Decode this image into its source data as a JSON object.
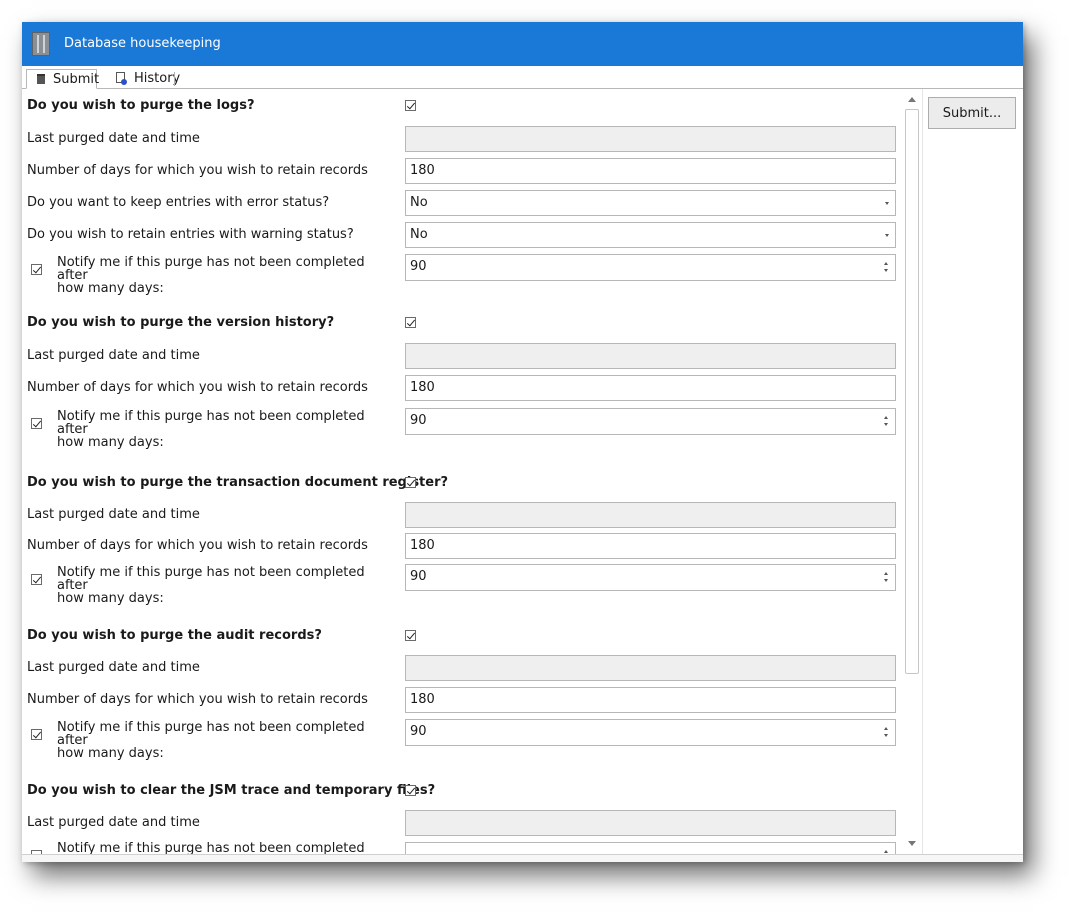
{
  "window": {
    "title": "Database housekeeping",
    "icon": "app-icon"
  },
  "tabs": [
    {
      "label": "Submit",
      "icon": "trash-icon",
      "active": true
    },
    {
      "label": "History",
      "icon": "history-icon",
      "active": false
    }
  ],
  "actions": {
    "submit_label": "Submit..."
  },
  "sections": [
    {
      "heading": "Do you wish to purge the logs?",
      "purge_checked": true,
      "last_purged_label": "Last purged date and time",
      "last_purged_value": "",
      "retain_label": "Number of days for which you wish to retain records",
      "retain_value": "180",
      "error_label": "Do you want to keep entries with error status?",
      "error_value": "No",
      "warning_label": "Do you wish to retain entries with warning status?",
      "warning_value": "No",
      "notify_checked": true,
      "notify_line1": "Notify me if this purge has not been completed after",
      "notify_line2": "how many days:",
      "notify_value": "90"
    },
    {
      "heading": "Do you wish to purge the version history?",
      "purge_checked": true,
      "last_purged_label": "Last purged date and time",
      "last_purged_value": "",
      "retain_label": "Number of days for which you wish to retain records",
      "retain_value": "180",
      "notify_checked": true,
      "notify_line1": "Notify me if this purge has not been completed after",
      "notify_line2": "how many days:",
      "notify_value": "90"
    },
    {
      "heading": "Do you wish to purge the transaction document register?",
      "purge_checked": true,
      "last_purged_label": "Last purged date and time",
      "last_purged_value": "",
      "retain_label": "Number of days for which you wish to retain records",
      "retain_value": "180",
      "notify_checked": true,
      "notify_line1": "Notify me if this purge has not been completed after",
      "notify_line2": "how many days:",
      "notify_value": "90"
    },
    {
      "heading": "Do you wish to purge the audit records?",
      "purge_checked": true,
      "last_purged_label": "Last purged date and time",
      "last_purged_value": "",
      "retain_label": "Number of days for which you wish to retain records",
      "retain_value": "180",
      "notify_checked": true,
      "notify_line1": "Notify me if this purge has not been completed after",
      "notify_line2": "how many days:",
      "notify_value": "90"
    },
    {
      "heading": "Do you wish to clear the JSM trace and temporary files?",
      "purge_checked": true,
      "last_purged_label": "Last purged date and time",
      "last_purged_value": "",
      "notify_checked": false,
      "notify_line1": "Notify me if this purge has not been completed after"
    }
  ]
}
